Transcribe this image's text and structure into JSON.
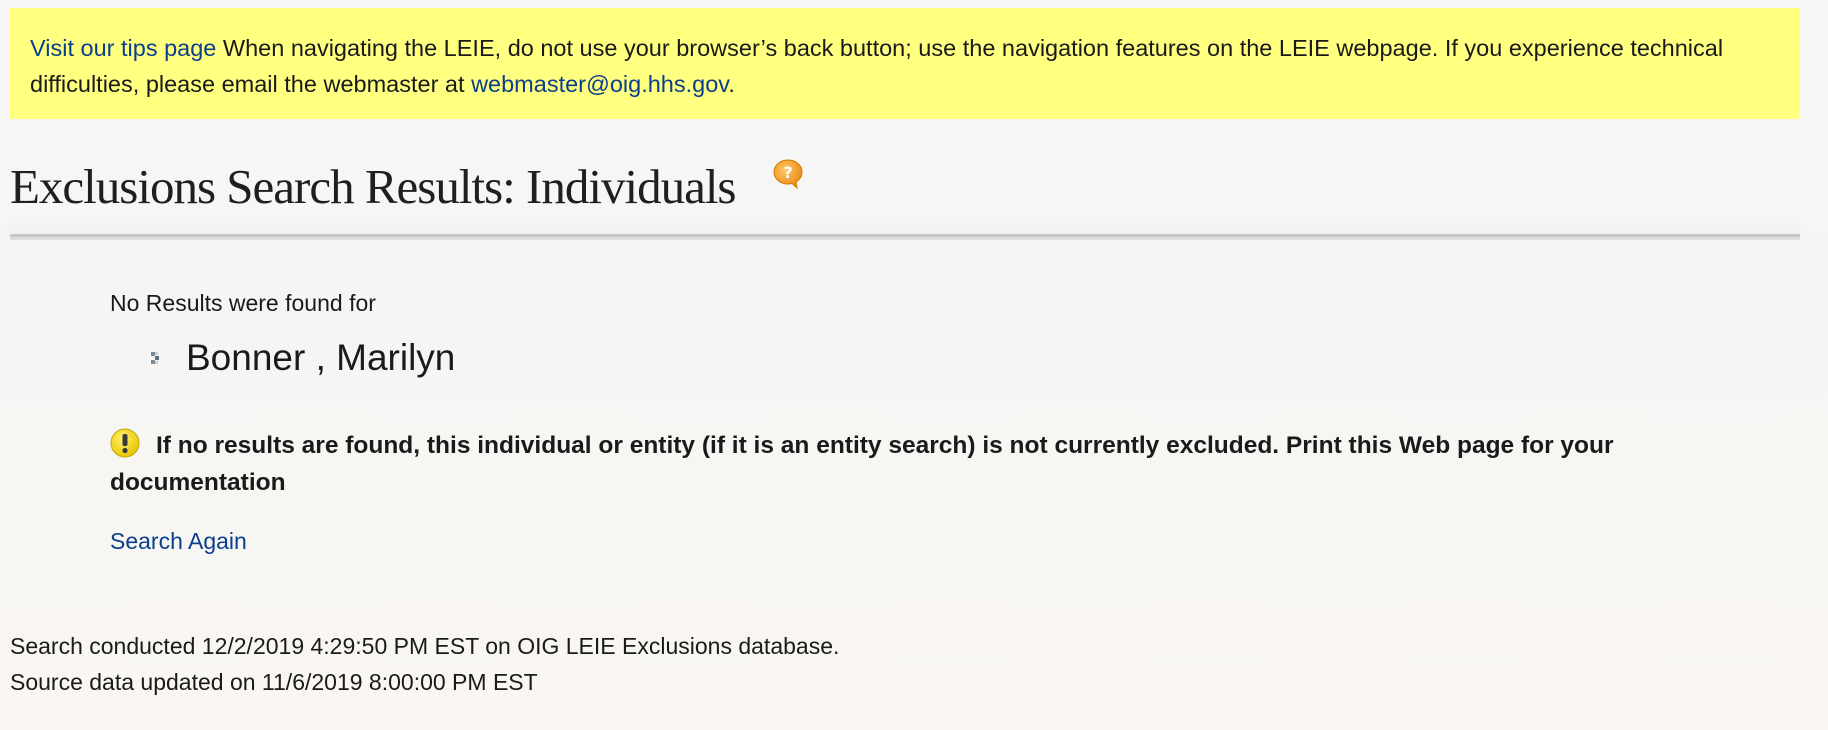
{
  "notice": {
    "tips_link": "Visit our tips page",
    "text": " When navigating the LEIE, do not use your browser’s back button; use the navigation features on the LEIE webpage. If you experience technical difficulties, please email the webmaster at ",
    "email": "webmaster@oig.hhs.gov",
    "end": "."
  },
  "header": {
    "title": "Exclusions Search Results: Individuals",
    "help_icon": "question-bubble-icon"
  },
  "results": {
    "no_results_label": "No Results were found for",
    "searched_name": "Bonner , Marilyn",
    "bullet_icon": "arrow-bullet-icon"
  },
  "warning": {
    "icon": "exclamation-icon",
    "text": "If no results are found, this individual or entity (if it is an entity search) is not currently excluded. Print this Web page for your documentation"
  },
  "actions": {
    "search_again": "Search Again"
  },
  "footer": {
    "search_conducted": "Search conducted 12/2/2019 4:29:50 PM EST on OIG LEIE Exclusions database.",
    "source_updated": "Source data updated on 11/6/2019 8:00:00 PM EST"
  },
  "colors": {
    "notice_bg": "#ffff80",
    "link": "#0b3f8c",
    "help_icon": "#f5a623",
    "warning_icon": "#f5d400"
  }
}
